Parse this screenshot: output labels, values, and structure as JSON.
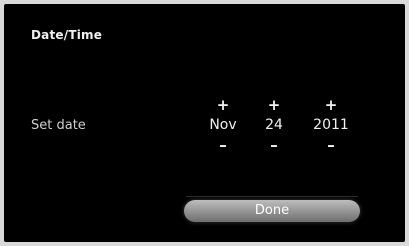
{
  "dialog": {
    "title": "Date/Time",
    "row_label": "Set date",
    "done_label": "Done"
  },
  "date_picker": {
    "increment_symbol": "+",
    "decrement_symbol": "–",
    "month": "Nov",
    "day": "24",
    "year": "2011"
  },
  "colors": {
    "background": "#000000",
    "text": "#f0f0f0",
    "button_gradient_top": "#bdbdbd",
    "button_gradient_bottom": "#6f6f6f"
  }
}
